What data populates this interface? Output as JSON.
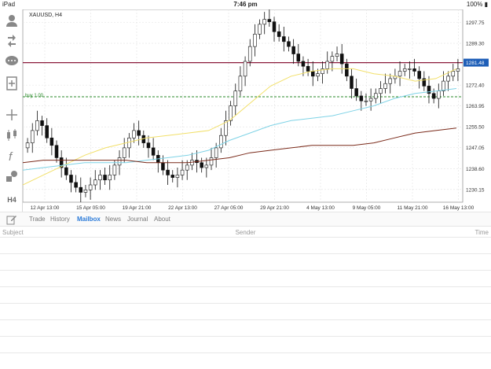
{
  "status": {
    "device": "iPad",
    "time": "7:46 pm",
    "battery": "100%"
  },
  "chart": {
    "symbol": "XAUUSD, H4",
    "order_label": "buy 1.00",
    "current_price": "1281.48",
    "price_ticks": [
      "1297.75",
      "1289.30",
      "1281.48",
      "1272.40",
      "1263.95",
      "1255.50",
      "1247.05",
      "1238.60",
      "1230.15"
    ],
    "time_labels": [
      "12 Apr 13:00",
      "15 Apr 05:00",
      "19 Apr 21:00",
      "22 Apr 13:00",
      "27 Apr 05:00",
      "29 Apr 21:00",
      "4 May 13:00",
      "9 May 05:00",
      "11 May 21:00",
      "16 May 13:00"
    ],
    "colors": {
      "price_line": "#8b1a3a",
      "order_line": "#2a8a2a",
      "ma_yellow": "#f2e06a",
      "ma_cyan": "#7fd3e6",
      "ma_brown": "#7a2a1a",
      "price_box": "#1f5fb8"
    }
  },
  "chart_data": {
    "type": "candlestick",
    "title": "XAUUSD, H4",
    "ylim": [
      1225,
      1303
    ],
    "close": [
      1249,
      1254,
      1258,
      1256,
      1251,
      1248,
      1243,
      1239,
      1236,
      1233,
      1231,
      1229,
      1230,
      1232,
      1234,
      1236,
      1234,
      1236,
      1240,
      1243,
      1247,
      1251,
      1254,
      1252,
      1249,
      1247,
      1244,
      1241,
      1238,
      1236,
      1235,
      1236,
      1238,
      1240,
      1242,
      1241,
      1239,
      1240,
      1243,
      1247,
      1252,
      1258,
      1264,
      1270,
      1276,
      1282,
      1288,
      1293,
      1297,
      1299,
      1298,
      1294,
      1292,
      1290,
      1288,
      1285,
      1282,
      1280,
      1278,
      1276,
      1277,
      1279,
      1282,
      1284,
      1285,
      1281,
      1276,
      1271,
      1268,
      1266,
      1266,
      1267,
      1269,
      1271,
      1273,
      1275,
      1276,
      1278,
      1279,
      1279,
      1278,
      1275,
      1272,
      1269,
      1267,
      1270,
      1274,
      1276,
      1278,
      1279
    ],
    "series": [
      {
        "name": "yellow",
        "values": [
          1232,
          1236,
          1240,
          1244,
          1247,
          1249,
          1251,
          1252,
          1253,
          1254,
          1258,
          1265,
          1272,
          1276,
          1278,
          1279,
          1279,
          1277,
          1276,
          1274,
          1275,
          1279
        ]
      },
      {
        "name": "cyan",
        "values": [
          1238,
          1239,
          1240,
          1241,
          1241,
          1241,
          1242,
          1243,
          1244,
          1246,
          1250,
          1253,
          1256,
          1258,
          1259,
          1260,
          1262,
          1264,
          1267,
          1269,
          1270,
          1271
        ]
      },
      {
        "name": "brown",
        "values": [
          1241,
          1242,
          1242,
          1242,
          1242,
          1242,
          1241,
          1241,
          1241,
          1242,
          1243,
          1245,
          1246,
          1247,
          1248,
          1248,
          1248,
          1249,
          1251,
          1253,
          1254,
          1255
        ]
      }
    ]
  },
  "tabs": [
    "Trade",
    "History",
    "Mailbox",
    "News",
    "Journal",
    "About"
  ],
  "active_tab": "Mailbox",
  "mail": {
    "col_subject": "Subject",
    "col_sender": "Sender",
    "col_time": "Time"
  }
}
